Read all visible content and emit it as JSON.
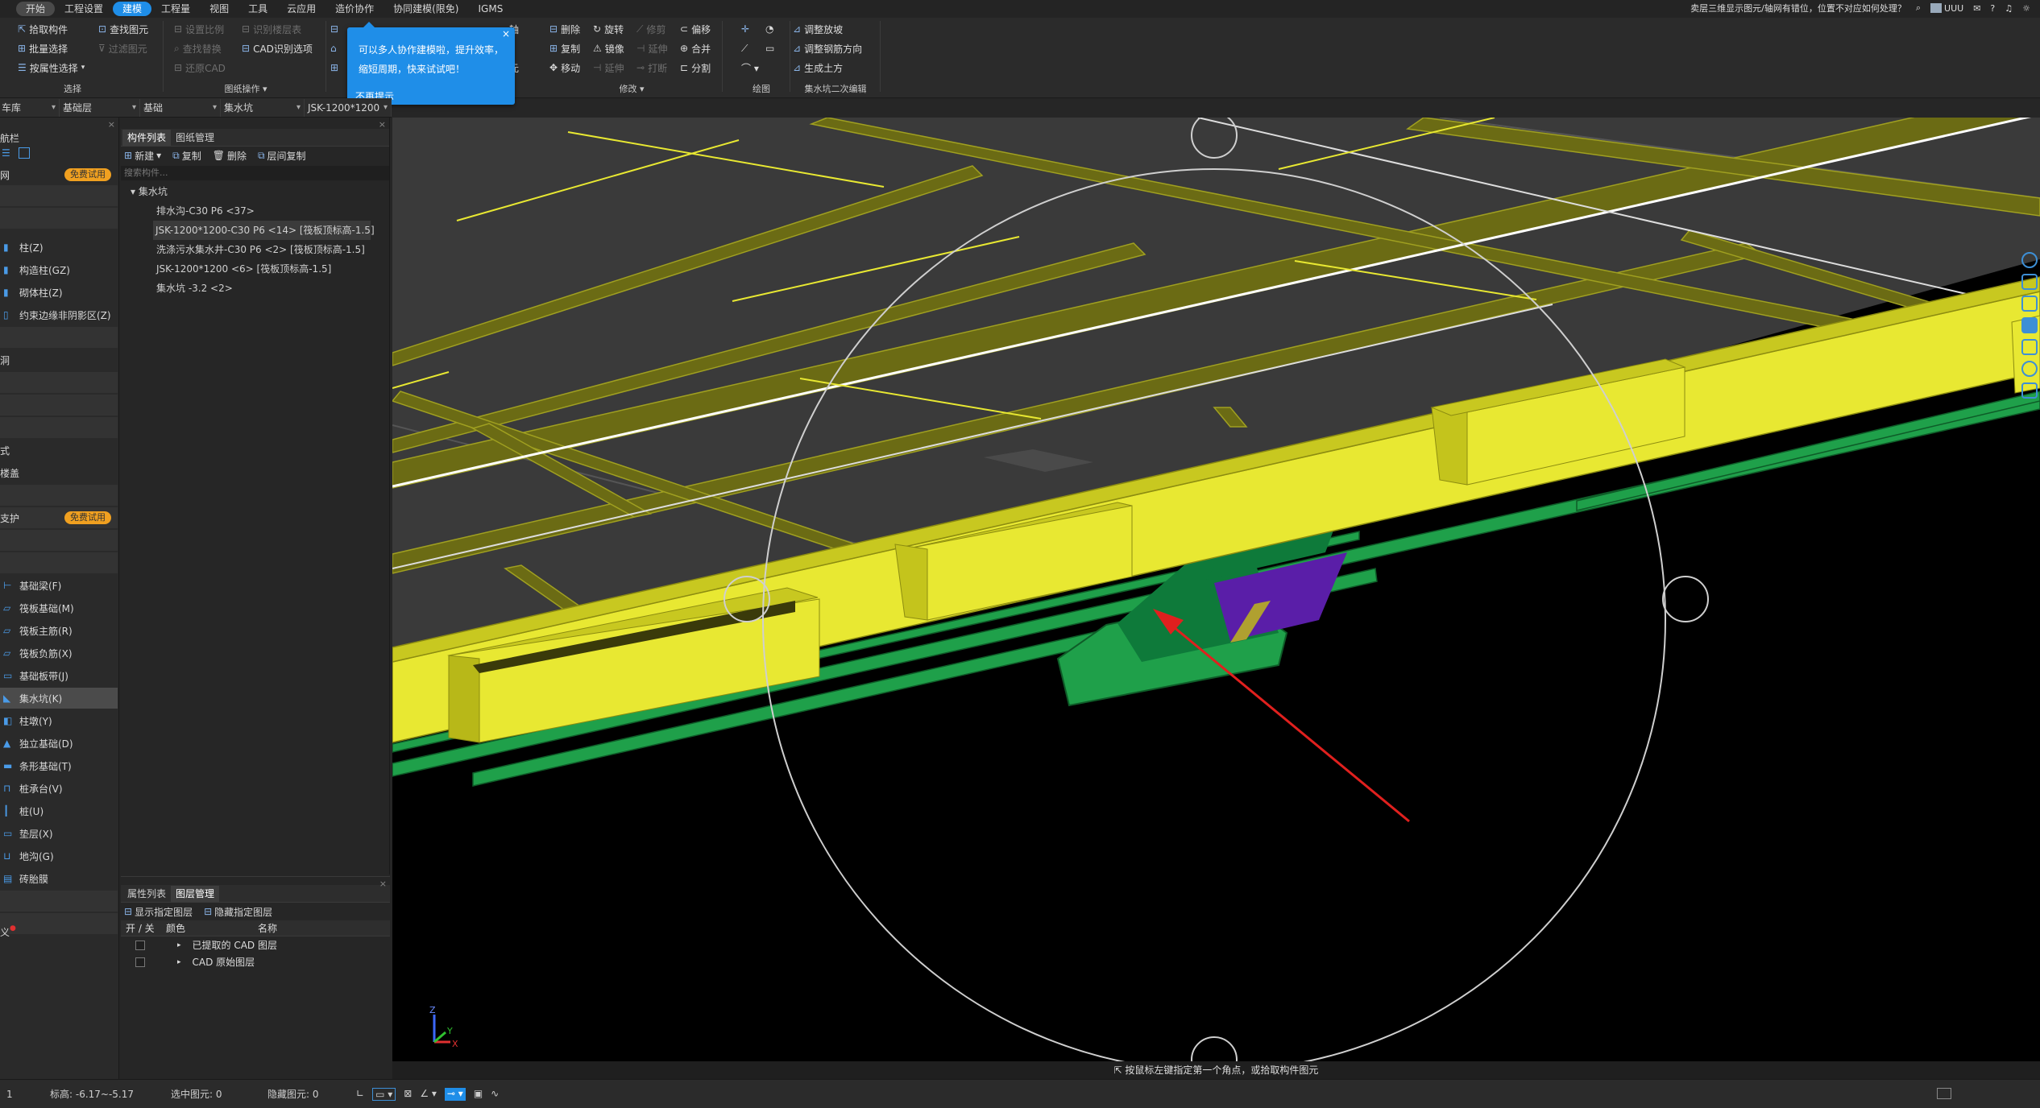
{
  "menubar": {
    "tabs": [
      "开始",
      "工程设置",
      "建模",
      "工程量",
      "视图",
      "工具",
      "云应用",
      "造价协作",
      "协同建模(限免)",
      "IGMS"
    ],
    "active_tab": "建模",
    "help_text": "卖层三维显示图元/轴网有错位，位置不对应如何处理？",
    "user": "UUU"
  },
  "ribbon": {
    "select_group": {
      "label": "选择",
      "items": [
        "拾取构件",
        "批量选择",
        "按属性选择"
      ],
      "extra": [
        "查找图元",
        "过滤图元"
      ]
    },
    "drawing_group": {
      "label": "图纸操作",
      "items": [
        "设置比例",
        "识别楼层表",
        "查找替换",
        "CAD识别选项",
        "还原CAD"
      ]
    },
    "modify_group": {
      "label": "修改",
      "items": [
        "删除",
        "旋转",
        "修剪",
        "偏移",
        "复制",
        "镜像",
        "延伸",
        "对齐",
        "合并",
        "移动",
        "打断",
        "分割"
      ]
    },
    "draw_group": {
      "label": "绘图"
    },
    "pit_group": {
      "label": "集水坑二次编辑",
      "items": [
        "调整放坡",
        "调整钢筋方向",
        "生成土方"
      ]
    }
  },
  "popup": {
    "text1": "可以多人协作建模啦，提升效率，",
    "text2": "缩短周期，快来试试吧！",
    "dismiss": "不再提示",
    "close": "×"
  },
  "filterbar": {
    "floor": "车库",
    "layer": "基础层",
    "category": "基础",
    "type": "集水坑",
    "component": "JSK-1200*1200"
  },
  "leftnav": {
    "header": "航栏",
    "free_badge": "免费试用",
    "items": [
      "柱(Z)",
      "构造柱(GZ)",
      "砌体柱(Z)",
      "约束边缘非阴影区(Z)",
      "洞",
      "式",
      "楼盖",
      "支护",
      "基础梁(F)",
      "筏板基础(M)",
      "筏板主筋(R)",
      "筏板负筋(X)",
      "基础板带(J)",
      "集水坑(K)",
      "柱墩(Y)",
      "独立基础(D)",
      "条形基础(T)",
      "桩承台(V)",
      "桩(U)",
      "垫层(X)",
      "地沟(G)",
      "砖胎膜",
      "义"
    ],
    "selected": "集水坑(K)"
  },
  "component_panel": {
    "tabs": [
      "构件列表",
      "图纸管理"
    ],
    "toolbar": [
      "新建",
      "复制",
      "删除",
      "层间复制"
    ],
    "search_placeholder": "搜索构件...",
    "tree_root": "集水坑",
    "items": [
      "排水沟-C30 P6 <37>",
      "JSK-1200*1200-C30 P6 <14> [筏板顶标高-1.5]",
      "洗涤污水集水井-C30 P6 <2> [筏板顶标高-1.5]",
      "JSK-1200*1200 <6> [筏板顶标高-1.5]",
      "集水坑 -3.2 <2>"
    ],
    "selected_index": 1
  },
  "props_panel": {
    "tabs": [
      "属性列表",
      "图层管理"
    ],
    "toolbar": [
      "显示指定图层",
      "隐藏指定图层"
    ],
    "columns": [
      "开 / 关",
      "颜色",
      "名称"
    ],
    "rows": [
      "已提取的 CAD 图层",
      "CAD 原始图层"
    ]
  },
  "viewport": {
    "hint": "按鼠标左键指定第一个角点，或拾取构件图元",
    "axis_labels": {
      "z": "Z",
      "y": "Y",
      "x": "X"
    }
  },
  "statusbar": {
    "floor_label": "1",
    "elevation": "标高:  -6.17~-5.17",
    "selected": "选中图元:  0",
    "hidden": "隐藏图元:  0"
  },
  "colors": {
    "accent": "#1f8ee8",
    "slab_yellow": "#e8e832",
    "green": "#1fa04a",
    "pit_purple": "#5a1ea8",
    "arrow_red": "#e0201e"
  }
}
